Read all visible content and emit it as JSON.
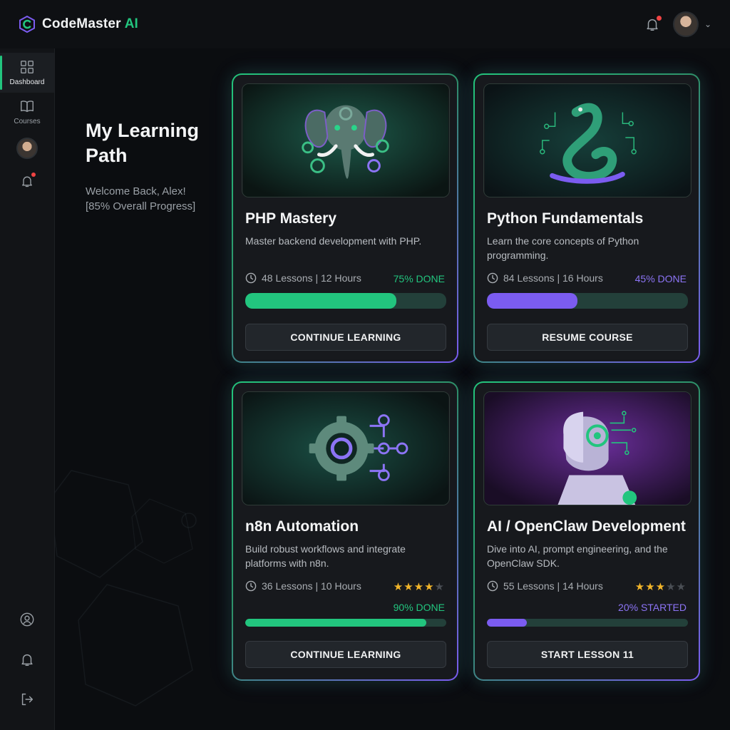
{
  "app": {
    "brand_name": "CodeMaster",
    "brand_suffix": "AI",
    "accent": "#22c57e",
    "accent_secondary": "#8c74f5"
  },
  "topbar": {
    "notification_icon": "bell-icon",
    "notification_badge": true,
    "avatar": "user-avatar",
    "menu_icon": "chevron-down-icon"
  },
  "sidebar": {
    "items": [
      {
        "label": "Dashboard",
        "icon": "grid-icon",
        "active": true
      },
      {
        "label": "Courses",
        "icon": "book-icon",
        "active": false
      }
    ],
    "bottom_icons": [
      "user-circle-icon",
      "bell-icon",
      "logout-icon"
    ]
  },
  "heading": {
    "title": "My Learning Path",
    "welcome": "Welcome Back, Alex!",
    "progress": "[85% Overall Progress]"
  },
  "courses": [
    {
      "title": "PHP Mastery",
      "description": "Master backend development with PHP.",
      "meta": "48 Lessons | 12 Hours",
      "status": "75% DONE",
      "progress": 0.75,
      "button": "CONTINUE LEARNING",
      "color": "#22c57e"
    },
    {
      "title": "Python Fundamentals",
      "description": "Learn the core concepts of Python programming.",
      "meta": "84 Lessons | 16 Hours",
      "status": "45% DONE",
      "progress": 0.45,
      "button": "RESUME COURSE",
      "color": "#7b5cf0"
    },
    {
      "title": "n8n Automation",
      "description": "Build robust workflows and integrate platforms with n8n.",
      "meta": "36 Lessons | 10 Hours",
      "status": "90% DONE",
      "progress": 0.9,
      "rating": 4,
      "button": "CONTINUE LEARNING",
      "color": "#22c57e"
    },
    {
      "title": "AI / OpenClaw Development",
      "description": "Dive into AI, prompt engineering, and the OpenClaw SDK.",
      "meta": "55 Lessons | 14 Hours",
      "status": "20% STARTED",
      "progress": 0.2,
      "rating": 3,
      "button": "START LESSON 11",
      "color": "#7b5cf0"
    }
  ]
}
